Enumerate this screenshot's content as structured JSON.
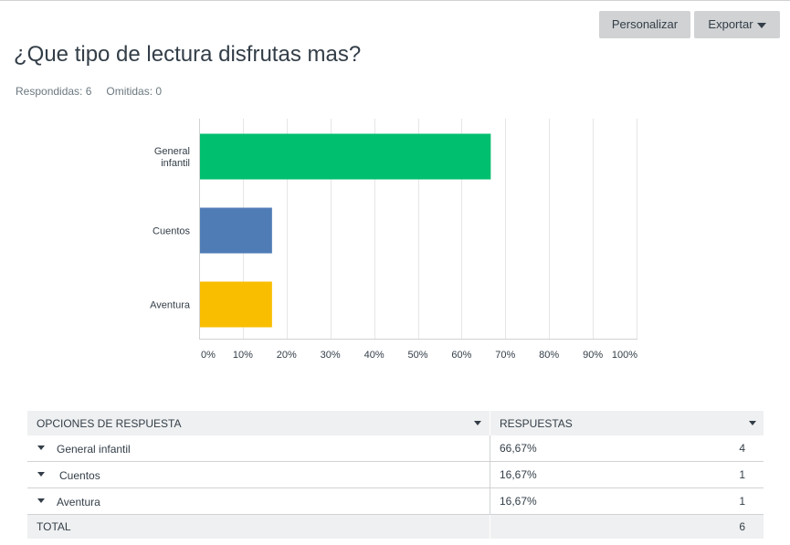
{
  "toolbar": {
    "customize_label": "Personalizar",
    "export_label": "Exportar"
  },
  "question": {
    "title": "¿Que tipo de lectura disfrutas mas?",
    "answered": "Respondidas: 6",
    "skipped": "Omitidas: 0"
  },
  "colors": {
    "series": [
      "#00bf6f",
      "#507cb6",
      "#f9be00"
    ],
    "grid": "#e6e6e6",
    "axis": "#d0d2d3",
    "text": "#333e48"
  },
  "chart_data": {
    "type": "bar",
    "orientation": "horizontal",
    "categories": [
      [
        "General",
        "infantil"
      ],
      [
        "Cuentos"
      ],
      [
        "Aventura"
      ]
    ],
    "values": [
      66.67,
      16.67,
      16.67
    ],
    "xlim": [
      0,
      100
    ],
    "ticks": [
      "0%",
      "10%",
      "20%",
      "30%",
      "40%",
      "50%",
      "60%",
      "70%",
      "80%",
      "90%",
      "100%"
    ],
    "grid": true,
    "title": "",
    "xlabel": "",
    "ylabel": ""
  },
  "table": {
    "headers": [
      "OPCIONES DE RESPUESTA",
      "RESPUESTAS"
    ],
    "rows": [
      {
        "label": "General infantil",
        "percent": "66,67%",
        "count": "4"
      },
      {
        "label": "Cuentos",
        "percent": "16,67%",
        "count": "1"
      },
      {
        "label": "Aventura",
        "percent": "16,67%",
        "count": "1"
      }
    ],
    "total_label": "TOTAL",
    "total_count": "6"
  }
}
